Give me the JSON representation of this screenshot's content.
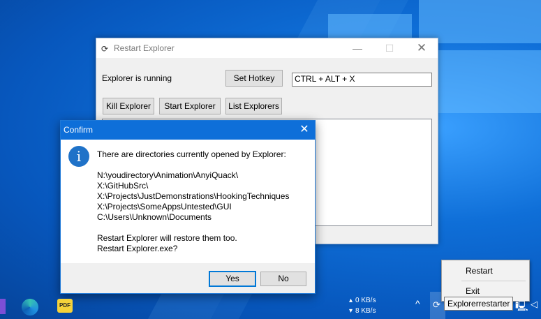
{
  "main_window": {
    "title": "Restart Explorer",
    "status_text": "Explorer is running",
    "set_hotkey_label": "Set Hotkey",
    "hotkey_value": "CTRL + ALT + X",
    "kill_label": "Kill Explorer",
    "start_label": "Start Explorer",
    "list_label": "List Explorers"
  },
  "dialog": {
    "title": "Confirm",
    "message": "There are directories currently opened by Explorer:",
    "paths": [
      "N:\\youdirectory\\Animation\\AnyiQuack\\",
      "X:\\GitHubSrc\\",
      "X:\\Projects\\JustDemonstrations\\HookingTechniques",
      "X:\\Projects\\SomeAppsUntested\\GUI",
      "C:\\Users\\Unknown\\Documents"
    ],
    "note": "Restart Explorer will restore them too.",
    "question": "Restart Explorer.exe?",
    "yes_label": "Yes",
    "no_label": "No"
  },
  "context_menu": {
    "restart_label": "Restart",
    "exit_label": "Exit"
  },
  "tray": {
    "tooltip": "Explorerrestarter",
    "upload": "0 KB/s",
    "download": "8 KB/s",
    "up_arrow": "▴",
    "down_arrow": "▾",
    "pdf_label": "PDF"
  }
}
